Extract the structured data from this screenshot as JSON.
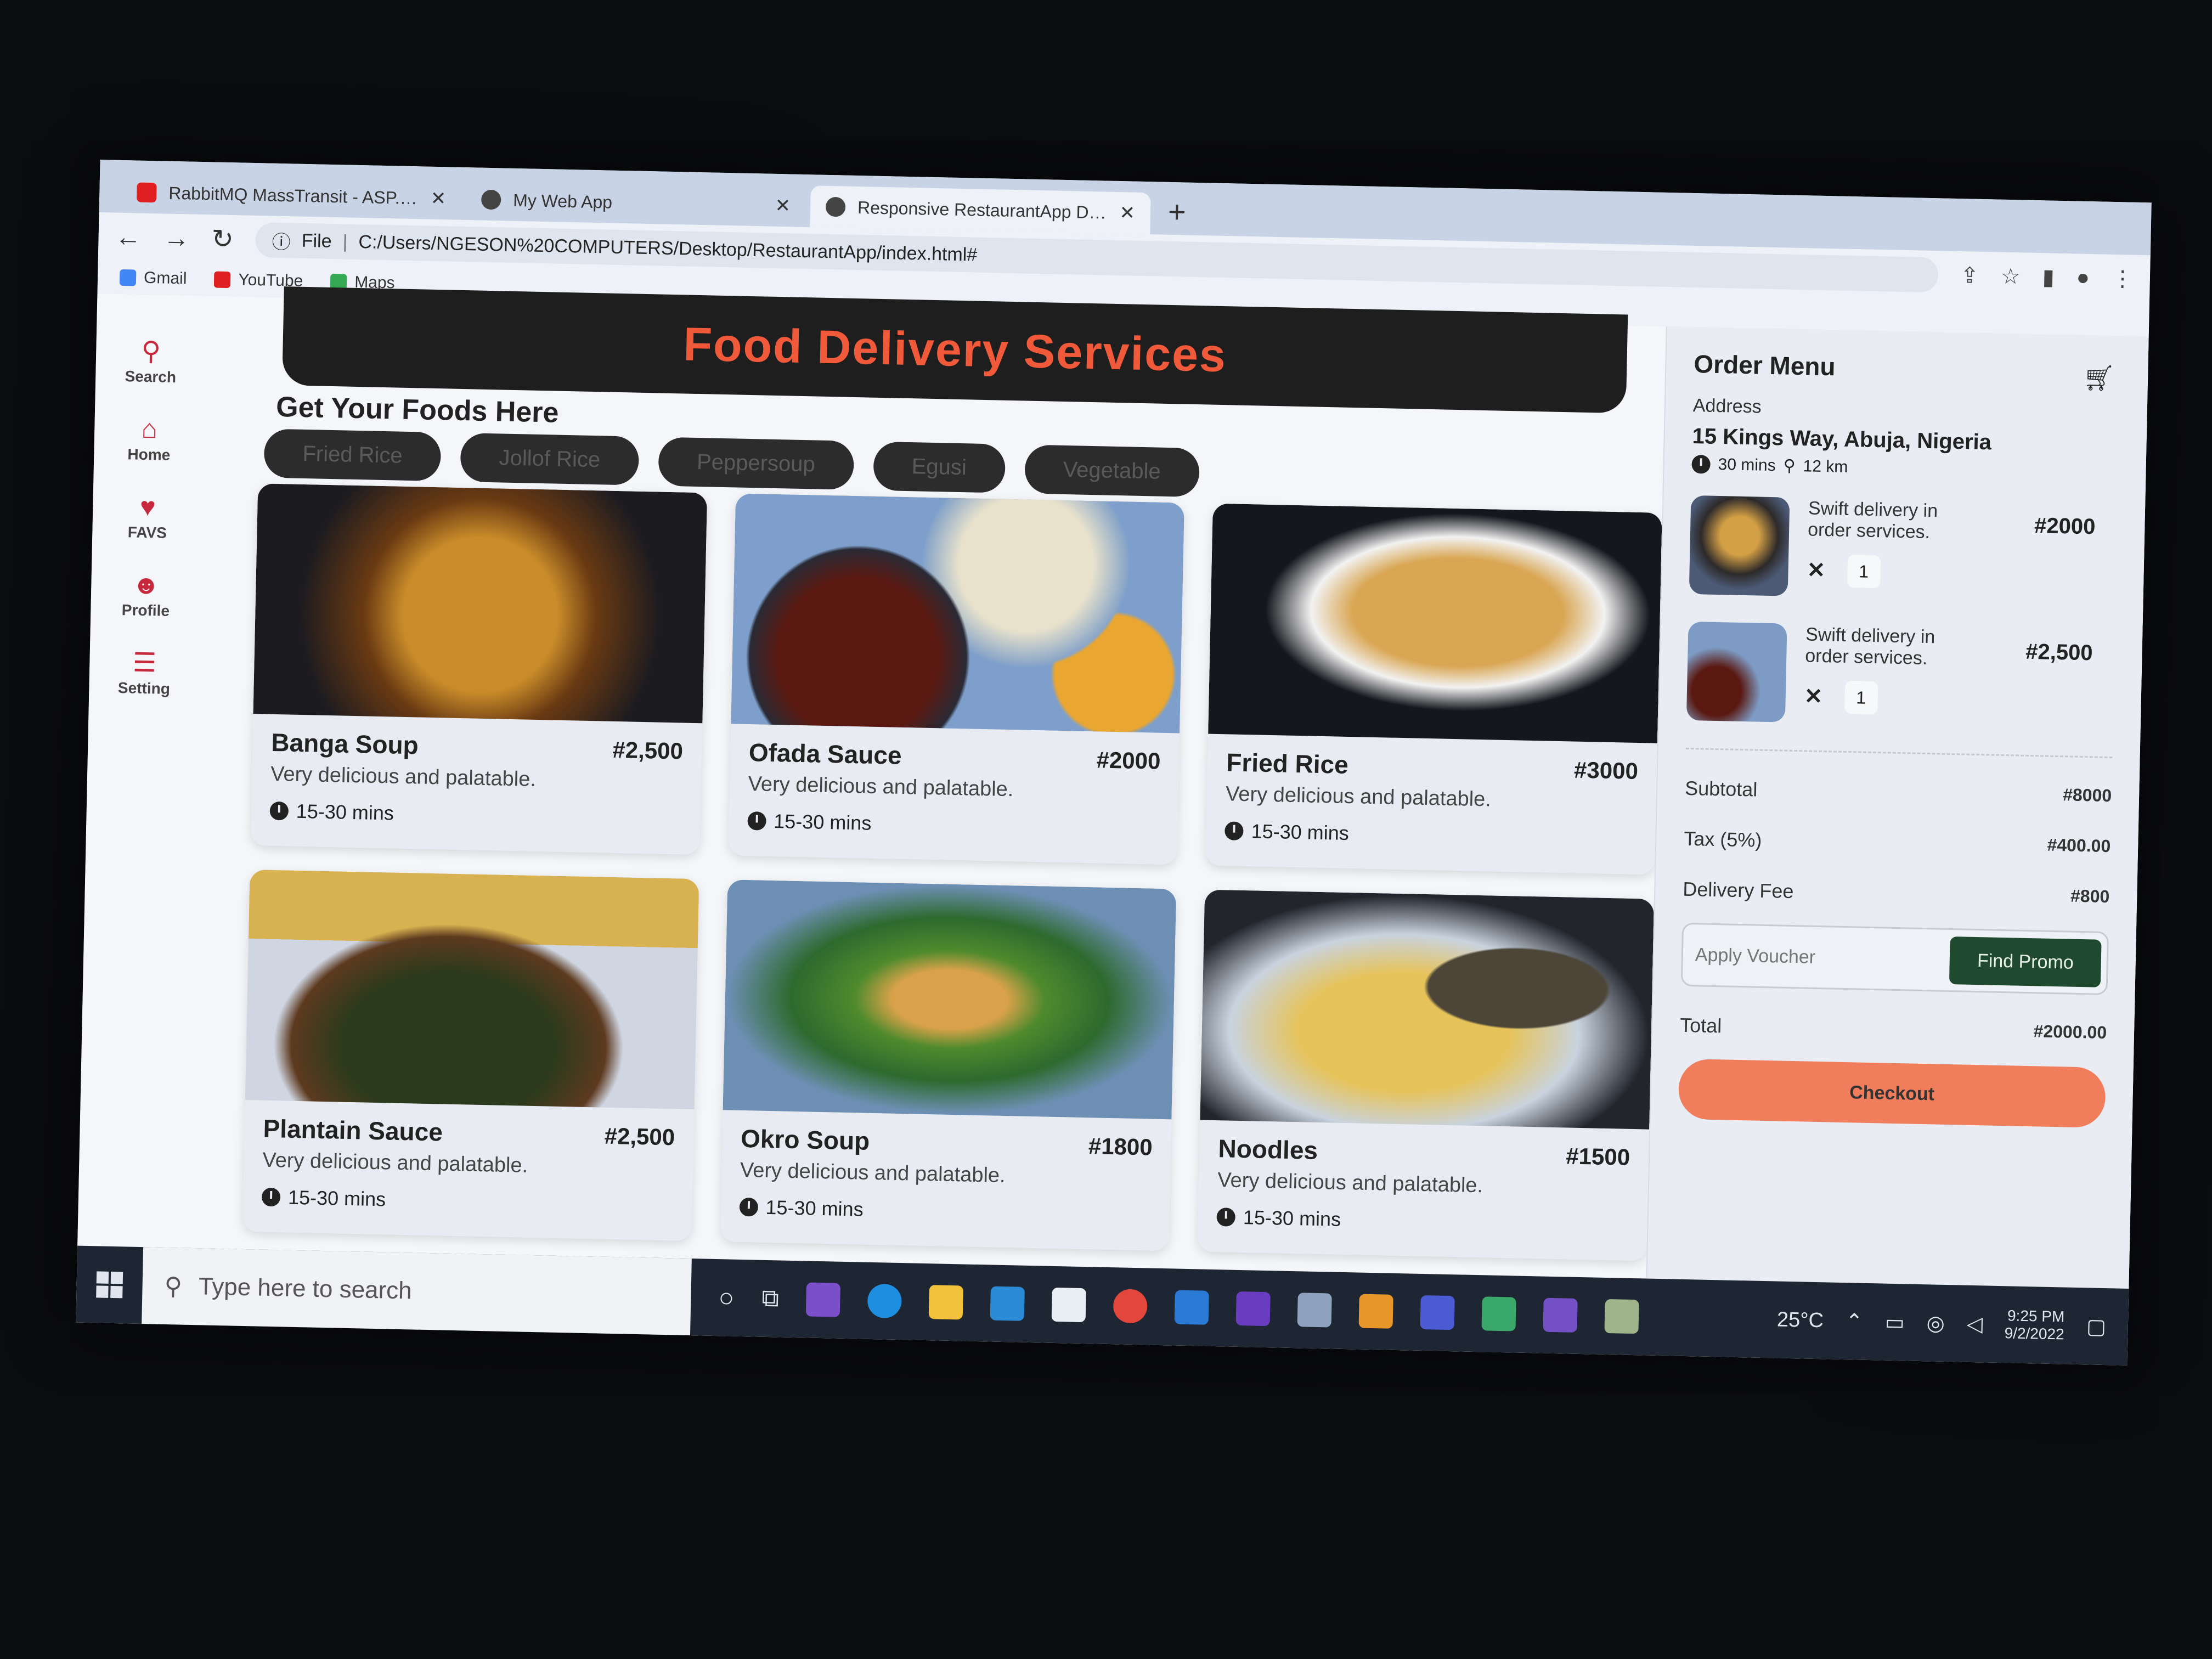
{
  "browser": {
    "tabs": [
      {
        "title": "RabbitMQ MassTransit - ASP.NET",
        "active": false
      },
      {
        "title": "My Web App",
        "active": false
      },
      {
        "title": "Responsive RestaurantApp Dashb",
        "active": true
      }
    ],
    "new_tab": "+",
    "address": {
      "scheme": "File",
      "url": "C:/Users/NGESON%20COMPUTERS/Desktop/RestaurantApp/index.html#"
    },
    "bookmarks": [
      "Gmail",
      "YouTube",
      "Maps"
    ]
  },
  "sidebar": {
    "items": [
      {
        "label": "Search",
        "icon": "search-icon"
      },
      {
        "label": "Home",
        "icon": "home-icon"
      },
      {
        "label": "FAVS",
        "icon": "heart-icon"
      },
      {
        "label": "Profile",
        "icon": "user-icon"
      },
      {
        "label": "Setting",
        "icon": "sliders-icon"
      }
    ]
  },
  "banner": {
    "title": "Food Delivery Services"
  },
  "main": {
    "subtitle": "Get Your Foods Here",
    "filters": [
      "Fried Rice",
      "Jollof Rice",
      "Peppersoup",
      "Egusi",
      "Vegetable"
    ],
    "foods": [
      {
        "name": "Banga Soup",
        "price": "#2,500",
        "desc": "Very delicious and palatable.",
        "time": "15-30 mins"
      },
      {
        "name": "Ofada Sauce",
        "price": "#2000",
        "desc": "Very delicious and palatable.",
        "time": "15-30 mins"
      },
      {
        "name": "Fried Rice",
        "price": "#3000",
        "desc": "Very delicious and palatable.",
        "time": "15-30 mins"
      },
      {
        "name": "Plantain Sauce",
        "price": "#2,500",
        "desc": "Very delicious and palatable.",
        "time": "15-30 mins"
      },
      {
        "name": "Okro Soup",
        "price": "#1800",
        "desc": "Very delicious and palatable.",
        "time": "15-30 mins"
      },
      {
        "name": "Noodles",
        "price": "#1500",
        "desc": "Very delicious and palatable.",
        "time": "15-30 mins"
      }
    ]
  },
  "order": {
    "title": "Order Menu",
    "address_label": "Address",
    "address": "15 Kings Way, Abuja, Nigeria",
    "eta": "30 mins",
    "distance": "12 km",
    "items": [
      {
        "desc": "Swift delivery in order services.",
        "price": "#2000",
        "qty": "1",
        "remove": "✕"
      },
      {
        "desc": "Swift delivery in order services.",
        "price": "#2,500",
        "qty": "1",
        "remove": "✕"
      }
    ],
    "subtotal_label": "Subtotal",
    "subtotal": "#8000",
    "tax_label": "Tax (5%)",
    "tax": "#400.00",
    "delivery_label": "Delivery Fee",
    "delivery": "#800",
    "voucher_placeholder": "Apply Voucher",
    "promo_button": "Find Promo",
    "total_label": "Total",
    "total": "#2000.00",
    "checkout": "Checkout"
  },
  "taskbar": {
    "search_placeholder": "Type here to search",
    "weather": "25°C",
    "time": "9:25 PM",
    "date": "9/2/2022"
  },
  "colors": {
    "accent": "#f05a3a",
    "sidebar_icon": "#c8283c",
    "promo": "#1f4a2f",
    "checkout": "#f07d5c"
  }
}
